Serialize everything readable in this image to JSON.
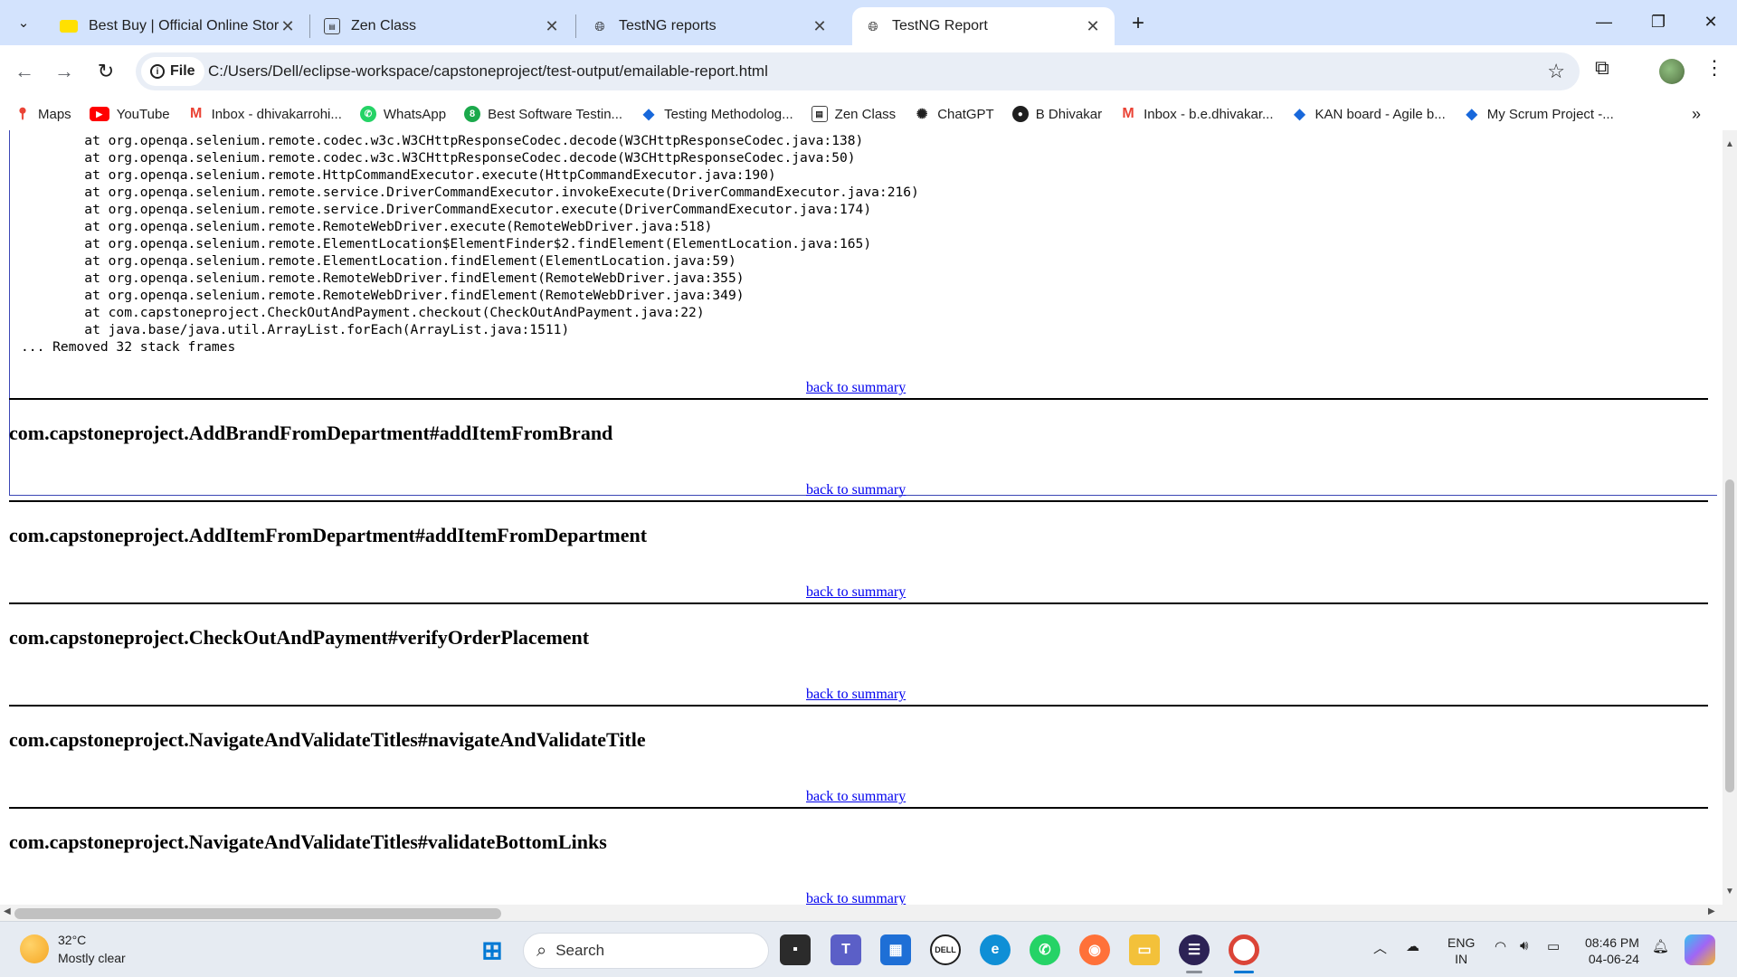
{
  "browser": {
    "tabs": [
      {
        "title": "Best Buy | Official Online Store |",
        "icon": "bestbuy-icon"
      },
      {
        "title": "Zen Class",
        "icon": "zen-class-icon"
      },
      {
        "title": "TestNG reports",
        "icon": "globe-icon"
      },
      {
        "title": "TestNG Report",
        "icon": "globe-icon",
        "active": true
      }
    ],
    "address": {
      "chip_label": "File",
      "url": "C:/Users/Dell/eclipse-workspace/capstoneproject/test-output/emailable-report.html"
    },
    "bookmarks": [
      {
        "label": "Maps",
        "icon": "maps-icon"
      },
      {
        "label": "YouTube",
        "icon": "youtube-icon"
      },
      {
        "label": "Inbox - dhivakarrohi...",
        "icon": "gmail-icon"
      },
      {
        "label": "WhatsApp",
        "icon": "whatsapp-icon"
      },
      {
        "label": "Best Software Testin...",
        "icon": "best-software-icon"
      },
      {
        "label": "Testing Methodolog...",
        "icon": "jira-icon"
      },
      {
        "label": "Zen Class",
        "icon": "zen-class-icon"
      },
      {
        "label": "ChatGPT",
        "icon": "chatgpt-icon"
      },
      {
        "label": "B Dhivakar",
        "icon": "github-icon"
      },
      {
        "label": "Inbox - b.e.dhivakar...",
        "icon": "gmail-icon"
      },
      {
        "label": "KAN board - Agile b...",
        "icon": "jira-icon"
      },
      {
        "label": "My Scrum Project -...",
        "icon": "jira-icon"
      }
    ]
  },
  "report": {
    "stack_trace": [
      "\tat org.openqa.selenium.remote.codec.w3c.W3CHttpResponseCodec.decode(W3CHttpResponseCodec.java:138)",
      "\tat org.openqa.selenium.remote.codec.w3c.W3CHttpResponseCodec.decode(W3CHttpResponseCodec.java:50)",
      "\tat org.openqa.selenium.remote.HttpCommandExecutor.execute(HttpCommandExecutor.java:190)",
      "\tat org.openqa.selenium.remote.service.DriverCommandExecutor.invokeExecute(DriverCommandExecutor.java:216)",
      "\tat org.openqa.selenium.remote.service.DriverCommandExecutor.execute(DriverCommandExecutor.java:174)",
      "\tat org.openqa.selenium.remote.RemoteWebDriver.execute(RemoteWebDriver.java:518)",
      "\tat org.openqa.selenium.remote.ElementLocation$ElementFinder$2.findElement(ElementLocation.java:165)",
      "\tat org.openqa.selenium.remote.ElementLocation.findElement(ElementLocation.java:59)",
      "\tat org.openqa.selenium.remote.RemoteWebDriver.findElement(RemoteWebDriver.java:355)",
      "\tat org.openqa.selenium.remote.RemoteWebDriver.findElement(RemoteWebDriver.java:349)",
      "\tat com.capstoneproject.CheckOutAndPayment.checkout(CheckOutAndPayment.java:22)",
      "\tat java.base/java.util.ArrayList.forEach(ArrayList.java:1511)",
      "... Removed 32 stack frames"
    ],
    "back_link_label": "back to summary",
    "tests": [
      "com.capstoneproject.AddBrandFromDepartment#addItemFromBrand",
      "com.capstoneproject.AddItemFromDepartment#addItemFromDepartment",
      "com.capstoneproject.CheckOutAndPayment#verifyOrderPlacement",
      "com.capstoneproject.NavigateAndValidateTitles#navigateAndValidateTitle",
      "com.capstoneproject.NavigateAndValidateTitles#validateBottomLinks"
    ]
  },
  "taskbar": {
    "weather_temp": "32°C",
    "weather_desc": "Mostly clear",
    "search_placeholder": "Search",
    "lang_line1": "ENG",
    "lang_line2": "IN",
    "time": "08:46 PM",
    "date": "04-06-24"
  }
}
